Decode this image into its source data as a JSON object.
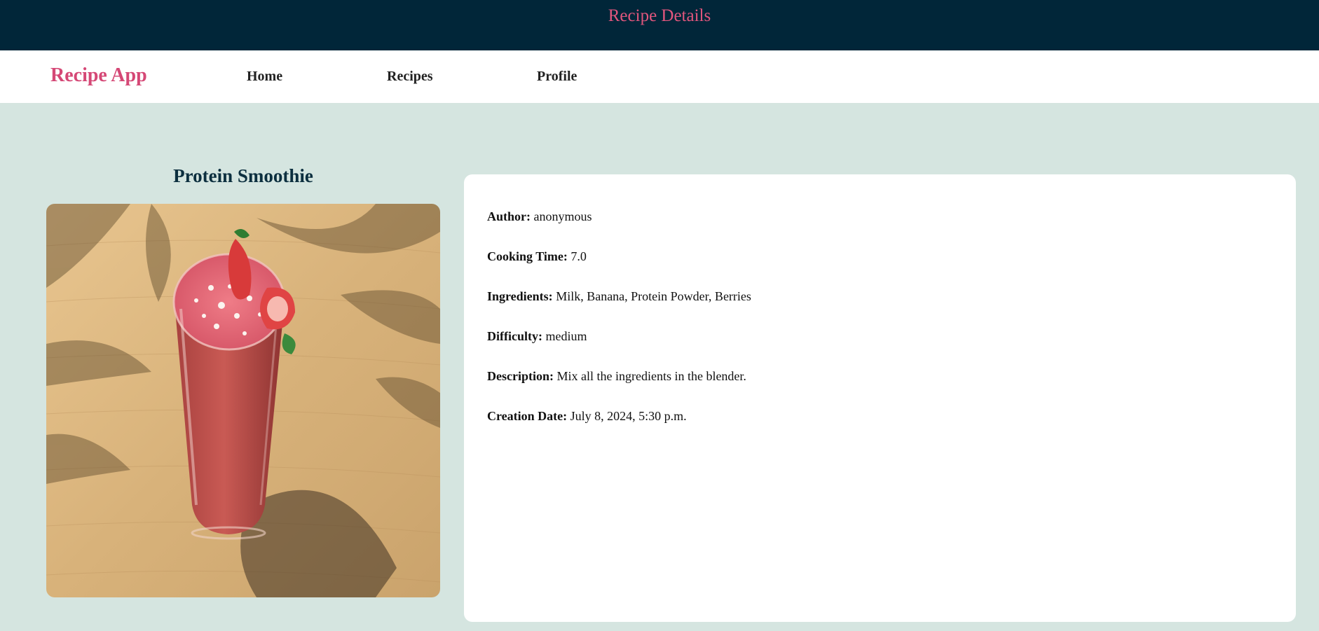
{
  "header": {
    "title": "Recipe Details"
  },
  "nav": {
    "brand": "Recipe App",
    "links": [
      "Home",
      "Recipes",
      "Profile"
    ]
  },
  "recipe": {
    "title": "Protein Smoothie",
    "image": "smoothie-photo",
    "details": [
      {
        "label": "Author:",
        "value": "anonymous"
      },
      {
        "label": "Cooking Time:",
        "value": "7.0"
      },
      {
        "label": "Ingredients:",
        "value": "Milk, Banana, Protein Powder, Berries"
      },
      {
        "label": "Difficulty:",
        "value": "medium"
      },
      {
        "label": "Description:",
        "value": "Mix all the ingredients in the blender."
      },
      {
        "label": "Creation Date:",
        "value": "July 8, 2024, 5:30 p.m."
      }
    ]
  },
  "colors": {
    "header_bg": "#012639",
    "accent": "#e2567d",
    "page_bg": "#d5e5e0"
  }
}
